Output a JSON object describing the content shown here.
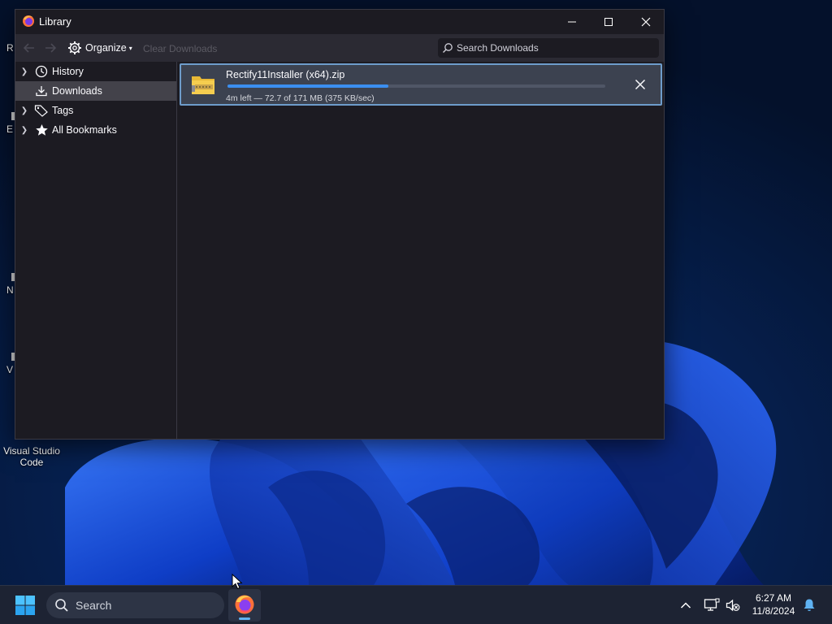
{
  "desktop": {
    "icons": [
      {
        "label": "Visual Studio Code"
      }
    ],
    "edge_fragments": [
      "R",
      "E",
      "N",
      "V"
    ]
  },
  "window": {
    "title": "Library",
    "controls": {
      "minimize": "minimize",
      "maximize": "maximize",
      "close": "close"
    }
  },
  "toolbar": {
    "organize_label": "Organize",
    "clear_label": "Clear Downloads",
    "search_placeholder": "Search Downloads"
  },
  "sidebar": {
    "items": [
      {
        "label": "History",
        "icon": "clock-icon",
        "expandable": true,
        "selected": false
      },
      {
        "label": "Downloads",
        "icon": "download-icon",
        "expandable": false,
        "selected": true
      },
      {
        "label": "Tags",
        "icon": "tag-icon",
        "expandable": true,
        "selected": false
      },
      {
        "label": "All Bookmarks",
        "icon": "star-icon",
        "expandable": true,
        "selected": false
      }
    ]
  },
  "downloads": [
    {
      "filename": "Rectify11Installer (x64).zip",
      "status": "4m left — 72.7 of 171 MB (375 KB/sec)",
      "progress_fraction": 0.425
    }
  ],
  "taskbar": {
    "search_label": "Search",
    "clock": {
      "time": "6:27 AM",
      "date": "11/8/2024"
    }
  },
  "colors": {
    "accent": "#3b8ff0",
    "selected_row": "#43424a",
    "window_bg": "#1c1b22",
    "toolbar_bg": "#2b2a33"
  }
}
